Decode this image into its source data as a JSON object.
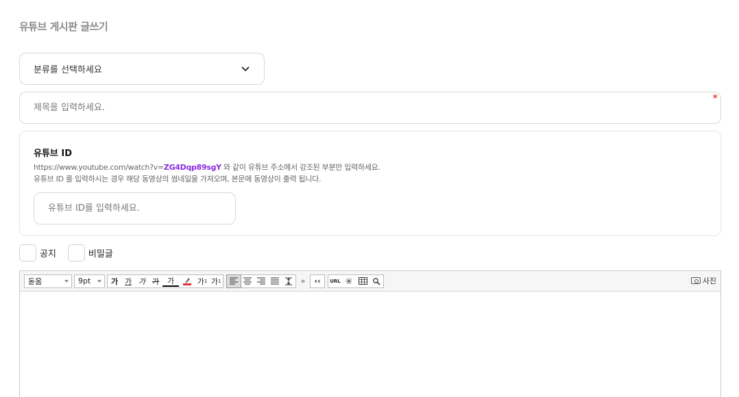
{
  "page": {
    "title": "유튜브 게시판 글쓰기"
  },
  "category_select": {
    "selected": "분류를 선택하세요"
  },
  "title_field": {
    "placeholder": "제목을 입력하세요.",
    "required_mark": "*"
  },
  "youtube": {
    "label": "유튜브 ID",
    "help_prefix": "https://www.youtube.com/watch?v=",
    "help_highlight": "ZG4Dqp89sgY",
    "help_suffix": " 와 같이 유튜브 주소에서 강조된 부분만 입력하세요.",
    "help_line2": "유튜브 ID 를 입력하시는 경우 해당 동영상의 썸네일을 가져오며, 본문에 동영상이 출력 됩니다.",
    "input_placeholder": "유튜브 ID를 입력하세요.",
    "highlight_color": "#8a2be2"
  },
  "options": {
    "notice_label": "공지",
    "secret_label": "비밀글"
  },
  "editor": {
    "font_family": "돋움",
    "font_size": "9pt",
    "btn_bold": "가",
    "btn_underline": "가",
    "btn_italic": "가",
    "btn_strike": "가",
    "btn_fontcolor": "가",
    "btn_superscript": "가",
    "btn_subscript": "가",
    "btn_more": "»",
    "btn_quote": "‹‹",
    "btn_url": "URL",
    "photo_label": "사진"
  }
}
